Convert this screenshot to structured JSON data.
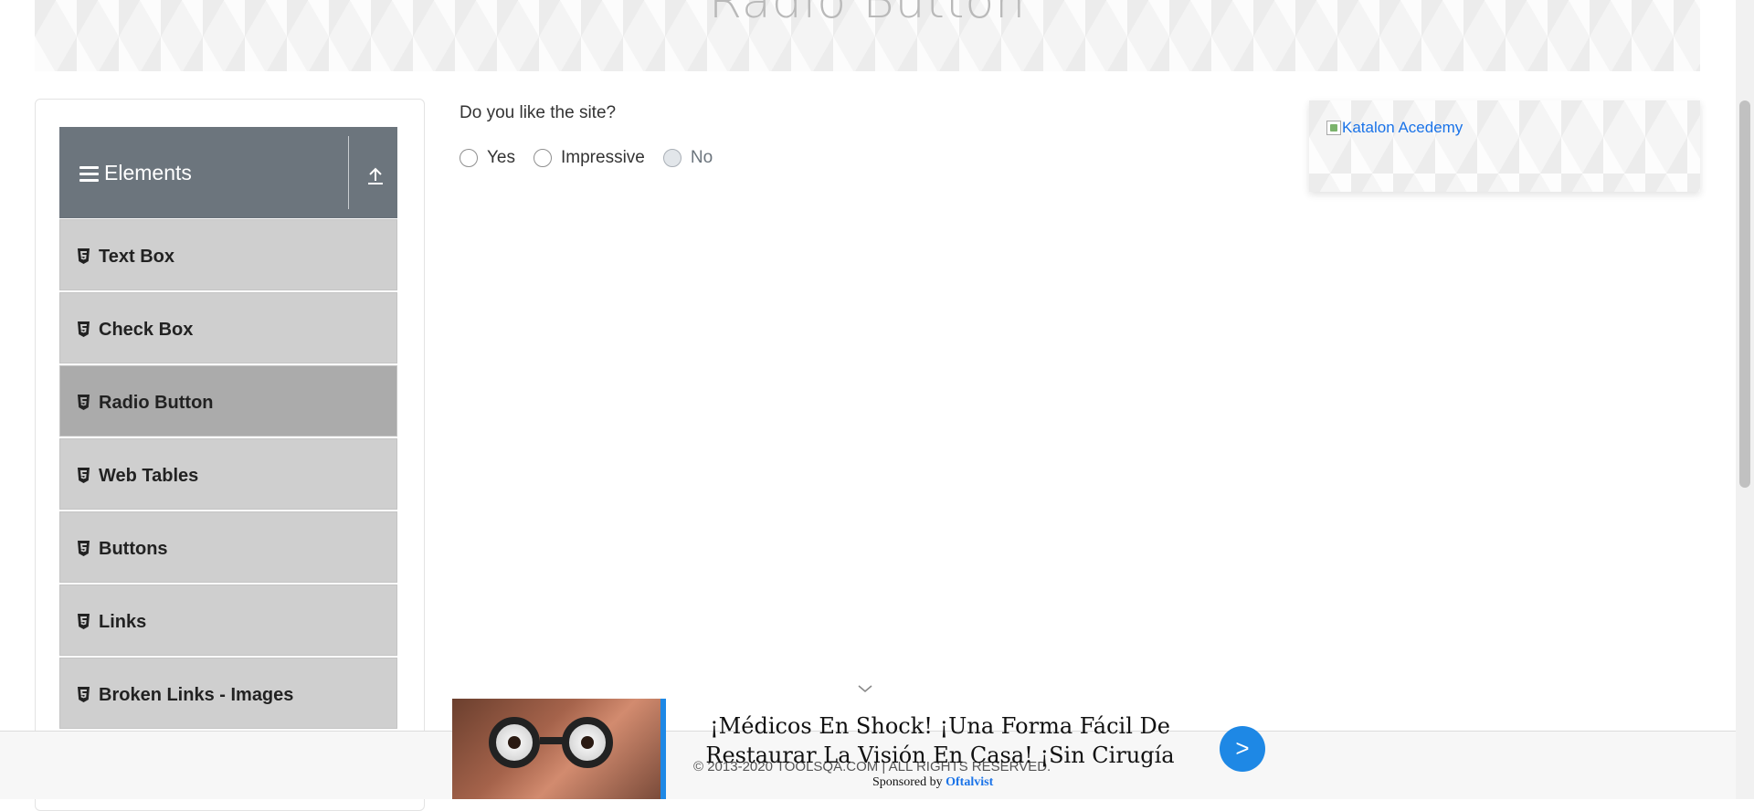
{
  "header": {
    "title": "Radio Button"
  },
  "sidebar": {
    "group_title": "Elements",
    "items": [
      {
        "label": "Text Box",
        "active": false
      },
      {
        "label": "Check Box",
        "active": false
      },
      {
        "label": "Radio Button",
        "active": true
      },
      {
        "label": "Web Tables",
        "active": false
      },
      {
        "label": "Buttons",
        "active": false
      },
      {
        "label": "Links",
        "active": false
      },
      {
        "label": "Broken Links - Images",
        "active": false
      }
    ]
  },
  "main": {
    "question": "Do you like the site?",
    "options": [
      {
        "label": "Yes",
        "disabled": false
      },
      {
        "label": "Impressive",
        "disabled": false
      },
      {
        "label": "No",
        "disabled": true
      }
    ]
  },
  "ad_card": {
    "image_alt": "Katalon Acedemy"
  },
  "footer": {
    "copyright": "© 2013-2020 TOOLSQA.COM | ALL RIGHTS RESERVED."
  },
  "sponsored": {
    "headline": "¡Médicos En Shock! ¡Una Forma Fácil De Restaurar La Visión En Casa! ¡Sin Cirugía",
    "sponsored_by_prefix": "Sponsored by",
    "sponsor": "Oftalvist",
    "cta": ">"
  },
  "colors": {
    "group_header": "#6c757d",
    "menu_item": "#cfcfcf",
    "menu_item_active": "#ababab",
    "link": "#1a73e8",
    "cta": "#1e88e5"
  }
}
